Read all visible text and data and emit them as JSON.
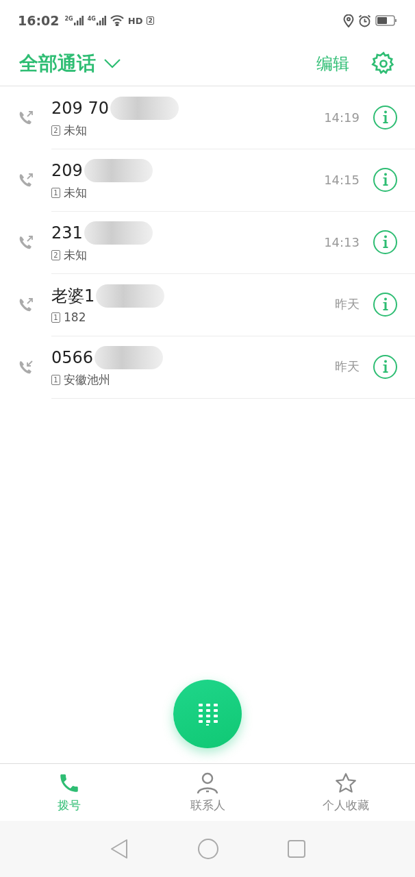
{
  "status_bar": {
    "time": "16:02",
    "networks": [
      "2G",
      "4G"
    ],
    "hd": "HD",
    "hd_sim": "2"
  },
  "header": {
    "title": "全部通话",
    "edit": "编辑"
  },
  "calls": [
    {
      "number": "209 70",
      "sim": "2",
      "detail": "未知",
      "time": "14:19",
      "kind": "outgoing",
      "redacted": true
    },
    {
      "number": "209",
      "sim": "1",
      "detail": "未知",
      "time": "14:15",
      "kind": "outgoing",
      "redacted": true
    },
    {
      "number": "231",
      "sim": "2",
      "detail": "未知",
      "time": "14:13",
      "kind": "outgoing",
      "redacted": true
    },
    {
      "number": "老婆1",
      "sim": "1",
      "detail": "182",
      "time": "昨天",
      "kind": "outgoing",
      "redacted": true
    },
    {
      "number": "0566",
      "sim": "1",
      "detail": "安徽池州",
      "time": "昨天",
      "kind": "incoming",
      "redacted": true
    }
  ],
  "tabs": [
    {
      "label": "拨号",
      "selected": true,
      "kind": "phone"
    },
    {
      "label": "联系人",
      "selected": false,
      "kind": "person"
    },
    {
      "label": "个人收藏",
      "selected": false,
      "kind": "star"
    }
  ]
}
